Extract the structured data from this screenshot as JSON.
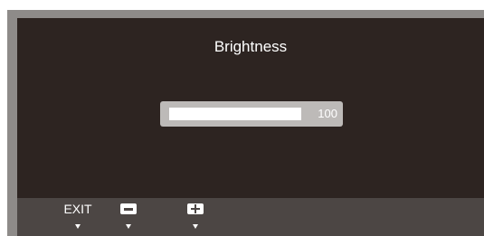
{
  "osd": {
    "title": "Brightness",
    "brightness": {
      "value": "100",
      "level_percent": 100
    }
  },
  "keys": {
    "exit_label": "EXIT",
    "minus_icon": "minus-icon",
    "plus_icon": "plus-icon",
    "arrow_icon": "arrow-down-icon"
  },
  "colors": {
    "panel_bg": "#2d2421",
    "keybar_bg": "#4c4644",
    "bezel": "#8e8b89",
    "slider_track": "#bdbab8",
    "slider_fill": "#ffffff"
  }
}
